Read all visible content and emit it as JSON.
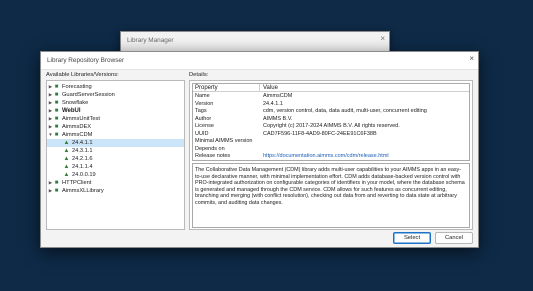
{
  "background_window": {
    "title": "Library Manager",
    "close_glyph": "×"
  },
  "dialog": {
    "title": "Library Repository Browser",
    "close_glyph": "×",
    "available_label": "Available Libraries/Versions:",
    "details_label": "Details:"
  },
  "tree": [
    {
      "label": "Forecasting",
      "type": "library",
      "expanded": false,
      "bold": false
    },
    {
      "label": "GuardServerSession",
      "type": "library",
      "expanded": false,
      "bold": false
    },
    {
      "label": "Snowflake",
      "type": "library",
      "expanded": false,
      "bold": false
    },
    {
      "label": "WebUI",
      "type": "library",
      "expanded": false,
      "bold": true
    },
    {
      "label": "AimmsUnitTest",
      "type": "library",
      "expanded": false,
      "bold": false
    },
    {
      "label": "AimmsDEX",
      "type": "library",
      "expanded": false,
      "bold": false
    },
    {
      "label": "AimmsCDM",
      "type": "library",
      "expanded": true,
      "bold": false
    },
    {
      "label": "24.4.1.1",
      "type": "version",
      "selected": true
    },
    {
      "label": "24.3.1.1",
      "type": "version"
    },
    {
      "label": "24.2.1.6",
      "type": "version"
    },
    {
      "label": "24.1.1.4",
      "type": "version"
    },
    {
      "label": "24.0.0.19",
      "type": "version"
    },
    {
      "label": "HTTPClient",
      "type": "library",
      "expanded": false,
      "bold": false
    },
    {
      "label": "AimmsXLLibrary",
      "type": "library",
      "expanded": false,
      "bold": false
    }
  ],
  "details": {
    "header": {
      "property": "Property",
      "value": "Value"
    },
    "rows": [
      {
        "property": "Name",
        "value": "AimmsCDM"
      },
      {
        "property": "Version",
        "value": "24.4.1.1"
      },
      {
        "property": "Tags",
        "value": "cdm, version control, data, data audit, multi-user, concurrent editing"
      },
      {
        "property": "Author",
        "value": "AIMMS B.V."
      },
      {
        "property": "License",
        "value": "Copyright (c) 2017-2024 AIMMS B.V. All rights reserved."
      },
      {
        "property": "UUID",
        "value": "CAD7F596-11F8-4AD9-80FC-24EE91C6F38B"
      },
      {
        "property": "Minimal AIMMS version",
        "value": ""
      },
      {
        "property": "Depends on",
        "value": ""
      },
      {
        "property": "Release notes",
        "value": "https://documentation.aimms.com/cdm/release.html",
        "link": true
      }
    ],
    "description": "The Collaborative Data Management (CDM) library adds multi-user capabilities to your AIMMS apps in an easy-to-use declarative manner, with minimal implementation effort. CDM adds database-backed version control with PRO-integrated authorization on configurable categories of identifiers in your model, where the database schema is generated and managed through the CDM service. CDM allows for such features as concurrent editing, branching and merging (with conflict resolution), checking out data from and reverting to data state at arbitrary commits, and auditing data changes."
  },
  "buttons": {
    "select": "Select",
    "cancel": "Cancel"
  }
}
